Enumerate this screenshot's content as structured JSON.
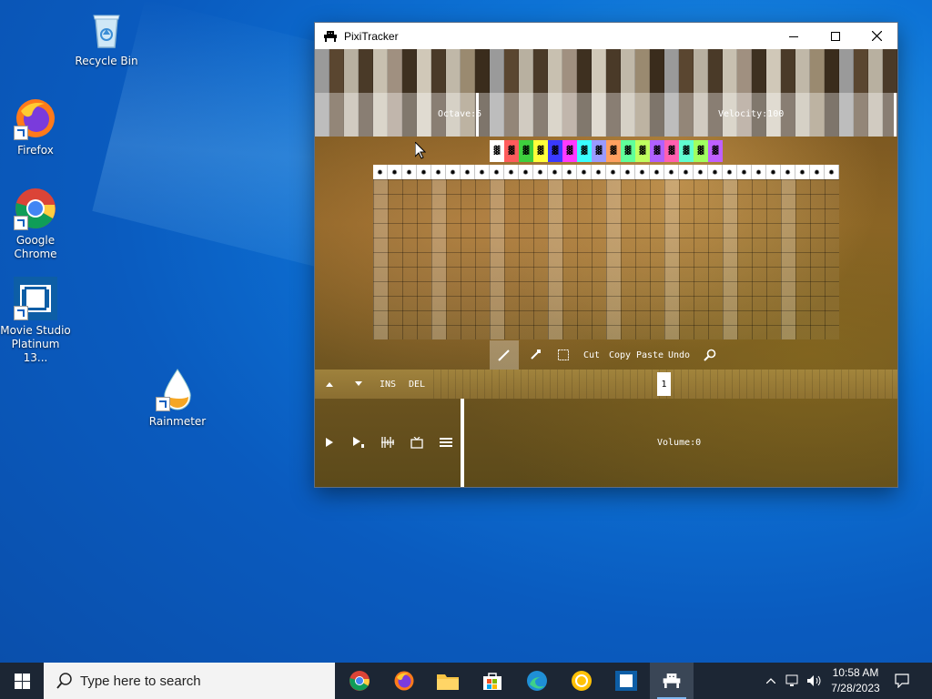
{
  "desktop": {
    "icons": [
      {
        "label": "Recycle Bin",
        "icon": "recycle-bin-icon"
      },
      {
        "label": "Firefox",
        "icon": "firefox-icon"
      },
      {
        "label": "Google Chrome",
        "icon": "chrome-icon"
      },
      {
        "label": "Movie Studio Platinum 13...",
        "icon": "movie-studio-icon"
      },
      {
        "label": "Rainmeter",
        "icon": "rainmeter-icon"
      }
    ]
  },
  "window": {
    "title": "PixiTracker",
    "icon": "pixitracker-icon",
    "controls": {
      "minimize": "minimize-icon",
      "maximize": "maximize-icon",
      "close": "close-icon"
    }
  },
  "tracker": {
    "octave_label": "Octave:5",
    "velocity_label": "Velocity:100",
    "palette_colors": [
      "#ffffff",
      "#ff5c5c",
      "#3ecf3e",
      "#ffff3a",
      "#3a3aff",
      "#ff3aff",
      "#3affff",
      "#9a9aff",
      "#ffa060",
      "#60ff9a",
      "#c0ff60",
      "#b060ff",
      "#ff60b0",
      "#60ffd0",
      "#a0ff60",
      "#c060ff"
    ],
    "channel_count": 32,
    "tools": {
      "pencil": "pencil-icon",
      "dropper": "eyedropper-icon",
      "select": "select-box-icon",
      "cut": "Cut",
      "copy": "Copy",
      "paste": "Paste",
      "undo": "Undo",
      "zoom": "magnifier-icon"
    },
    "sequence": {
      "up": "arrow-up-icon",
      "down": "arrow-down-icon",
      "ins": "INS",
      "del": "DEL",
      "pattern_number": "1"
    },
    "transport": {
      "play": "play-icon",
      "play_pattern": "play-pattern-icon",
      "waveform": "waveform-icon",
      "tv": "tv-icon",
      "menu": "menu-icon"
    },
    "volume_label": "Volume:0"
  },
  "taskbar": {
    "search_placeholder": "Type here to search",
    "apps": [
      "chrome-icon",
      "firefox-icon",
      "file-explorer-icon",
      "store-icon",
      "edge-icon",
      "norton-icon",
      "movie-studio-icon",
      "pixitracker-icon"
    ],
    "time": "10:58 AM",
    "date": "7/28/2023"
  }
}
